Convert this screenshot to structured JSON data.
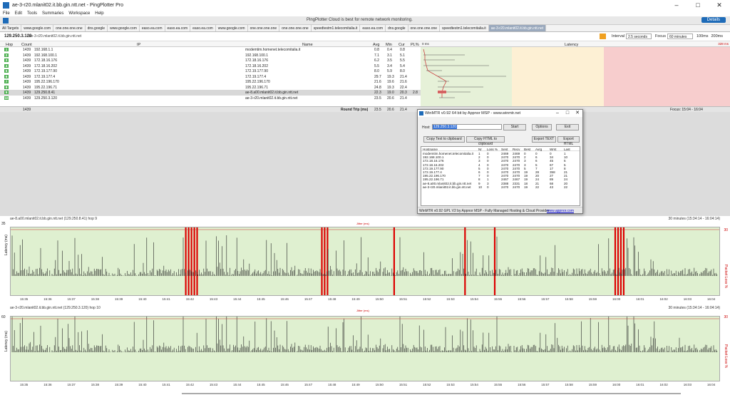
{
  "window": {
    "title": "ae-3-r20.mlanit02.it.bb.gin.ntt.net - PingPlotter Pro",
    "controls": [
      "–",
      "□",
      "✕"
    ]
  },
  "menu": [
    "File",
    "Edit",
    "Tools",
    "Summaries",
    "Workspace",
    "Help"
  ],
  "promo": {
    "text": "PingPlotter Cloud is best for remote network monitoring.",
    "details_label": "Details"
  },
  "tabs": [
    "All Targets",
    "www.google.com",
    "one.one.one.one",
    "dns.google",
    "www.google.com",
    "easo.ea.com",
    "easo.ea.com",
    "easo.ea.com",
    "www.google.com",
    "one.one.one.one",
    "one.one.one.one",
    "speedtestm1.telecomitalia.it",
    "easo.ea.com",
    "dns.google",
    "one.one.one.one",
    "speedtestm1.telecomitalia.it",
    "ae-3-r20.mlanit02.it.bb.gin.ntt.net"
  ],
  "address": {
    "ip": "129.250.3.120",
    "path": "/ ae-3-r20.mlanit02.it.bb.gin.ntt.net"
  },
  "controls": {
    "interval_label": "Interval",
    "interval_value": "2.5 seconds",
    "focus_label": "Focus",
    "focus_value": "60 minutes",
    "legend_100": "100ms",
    "legend_200": "200ms"
  },
  "trace_headers": {
    "hop": "Hop",
    "count": "Count",
    "ip": "IP",
    "name": "Name",
    "avg": "Avg",
    "min": "Min",
    "cur": "Cur",
    "pl": "PL%",
    "latency": "Latency",
    "scale0": "0 ms",
    "scale_max": "328 ms"
  },
  "trace_rows": [
    {
      "hop": "1",
      "count": "1439",
      "ip": "192.168.1.1",
      "name": "modemtim.homenet.telecomitalia.it",
      "avg": "0.8",
      "min": "0.4",
      "cur": "0.8",
      "pl": ""
    },
    {
      "hop": "2",
      "count": "1439",
      "ip": "192.168.100.1",
      "name": "192.168.100.1",
      "avg": "7.1",
      "min": "3.1",
      "cur": "5.1",
      "pl": ""
    },
    {
      "hop": "3",
      "count": "1439",
      "ip": "172.18.16.176",
      "name": "172.18.16.176",
      "avg": "6.2",
      "min": "3.5",
      "cur": "5.5",
      "pl": ""
    },
    {
      "hop": "4",
      "count": "1439",
      "ip": "172.18.16.202",
      "name": "172.18.16.202",
      "avg": "5.5",
      "min": "3.4",
      "cur": "5.4",
      "pl": ""
    },
    {
      "hop": "5",
      "count": "1439",
      "ip": "172.19.177.90",
      "name": "172.19.177.90",
      "avg": "8.0",
      "min": "5.9",
      "cur": "8.0",
      "pl": ""
    },
    {
      "hop": "6",
      "count": "1439",
      "ip": "172.19.177.4",
      "name": "172.19.177.4",
      "avg": "29.7",
      "min": "19.3",
      "cur": "21.4",
      "pl": ""
    },
    {
      "hop": "7",
      "count": "1439",
      "ip": "195.22.196.170",
      "name": "195.22.196.170",
      "avg": "21.6",
      "min": "19.6",
      "cur": "21.6",
      "pl": ""
    },
    {
      "hop": "8",
      "count": "1439",
      "ip": "195.22.196.71",
      "name": "195.22.196.71",
      "avg": "24.8",
      "min": "19.3",
      "cur": "22.4",
      "pl": ""
    },
    {
      "hop": "9",
      "count": "1439",
      "ip": "129.250.8.41",
      "name": "ae-8.a00.mlanit02.it.bb.gin.ntt.net",
      "avg": "22.3",
      "min": "19.0",
      "cur": "20.3",
      "pl": "2.8"
    },
    {
      "hop": "10",
      "count": "1439",
      "ip": "129.250.3.120",
      "name": "ae-3-r20.mlanit02.it.bb.gin.ntt.net",
      "avg": "23.5",
      "min": "20.6",
      "cur": "21.4",
      "pl": ""
    }
  ],
  "summary": {
    "count": "1439",
    "label": "Round Trip (ms)",
    "avg": "23.5",
    "min": "20.6",
    "cur": "21.4",
    "focus": "Focus: 15:04 - 16:04"
  },
  "winmtr": {
    "title": "WinMTR v0.92 64 bit by Appnor MSP - www.winmtr.net",
    "host_label": "Host:",
    "host_value": "129.250.3.120",
    "start": "Start",
    "options": "Options",
    "exit": "Exit",
    "copy_text": "Copy Text to clipboard",
    "copy_html": "Copy HTML to clipboard",
    "export_text": "Export TEXT",
    "export_html": "Export HTML",
    "columns": [
      "Hostname",
      "Nr",
      "Loss %",
      "Sent",
      "Recv",
      "Best",
      "Avrg",
      "Wrst",
      "Last"
    ],
    "rows": [
      [
        "modemtim.homenet.telecomitalia.it",
        "1",
        "0",
        "2469",
        "2469",
        "0",
        "0",
        "0",
        "1"
      ],
      [
        "192.168.100.1",
        "2",
        "0",
        "2470",
        "2470",
        "2",
        "6",
        "34",
        "10"
      ],
      [
        "172.18.16.176",
        "3",
        "0",
        "2470",
        "2470",
        "3",
        "6",
        "45",
        "5"
      ],
      [
        "172.18.16.202",
        "4",
        "0",
        "2470",
        "2470",
        "3",
        "5",
        "67",
        "5"
      ],
      [
        "172.19.177.90",
        "5",
        "0",
        "2470",
        "2470",
        "5",
        "7",
        "17",
        "8"
      ],
      [
        "172.19.177.4",
        "6",
        "0",
        "2470",
        "2470",
        "19",
        "28",
        "358",
        "21"
      ],
      [
        "195.22.196.170",
        "7",
        "0",
        "2470",
        "2470",
        "19",
        "20",
        "27",
        "21"
      ],
      [
        "195.22.196.71",
        "8",
        "1",
        "2467",
        "2467",
        "19",
        "24",
        "89",
        "24"
      ],
      [
        "ae-8.a00.mlanit02.it.bb.gin.ntt.net",
        "9",
        "3",
        "2388",
        "2331",
        "18",
        "21",
        "68",
        "20"
      ],
      [
        "ae-3-r20.mlanit02.it.bb.gin.ntt.net",
        "10",
        "0",
        "2470",
        "2470",
        "19",
        "22",
        "43",
        "22"
      ]
    ],
    "status": "WinMTR v0.92 GPL V2 by Appnor MSP - Fully Managed Hosting & Cloud Provider",
    "link": "www.appnor.com"
  },
  "graph1": {
    "title": "ae-8.a00.mlanit02.it.bb.gin.ntt.net (129.250.8.41) hop 9",
    "range": "30 minutes (15:34:14 - 16:04:14)",
    "ymax": "35",
    "ylabel": "Latency (ms)",
    "rlabel": "Packet Loss %",
    "rmax": "30",
    "jitter": "Jitter (ms)",
    "times": [
      "15:35",
      "15:36",
      "15:37",
      "15:38",
      "15:39",
      "15:40",
      "15:41",
      "15:42",
      "15:43",
      "15:44",
      "15:45",
      "15:46",
      "15:47",
      "15:48",
      "15:49",
      "15:50",
      "15:51",
      "15:52",
      "15:53",
      "15:54",
      "15:55",
      "15:56",
      "15:57",
      "15:58",
      "15:59",
      "16:00",
      "16:01",
      "16:02",
      "16:03",
      "16:04"
    ],
    "loss_marks": [
      0.246,
      0.25,
      0.254,
      0.258,
      0.262,
      0.438,
      0.442,
      0.446,
      0.54,
      0.64,
      0.682,
      0.852,
      0.856,
      0.86,
      0.864
    ]
  },
  "graph2": {
    "title": "ae-3-r20.mlanit02.it.bb.gin.ntt.net (129.250.3.120) hop 10",
    "range": "30 minutes (15:34:14 - 16:04:14)",
    "ymax": "60",
    "ylabel": "Latency (ms)",
    "rlabel": "Packet Loss %",
    "rmax": "30",
    "jitter": "Jitter (ms)",
    "times": [
      "15:35",
      "15:36",
      "15:37",
      "15:38",
      "15:39",
      "15:40",
      "15:41",
      "15:42",
      "15:43",
      "15:44",
      "15:45",
      "15:46",
      "15:47",
      "15:48",
      "15:49",
      "15:50",
      "15:51",
      "15:52",
      "15:53",
      "15:54",
      "15:55",
      "15:56",
      "15:57",
      "15:58",
      "15:59",
      "16:00",
      "16:01",
      "16:02",
      "16:03",
      "16:04"
    ]
  },
  "colors": {
    "accent": "#1e6bb8",
    "good": "#e6f1d8",
    "warn": "#fdf0d4",
    "bad": "#f7cdcd",
    "loss": "#dd0000"
  }
}
